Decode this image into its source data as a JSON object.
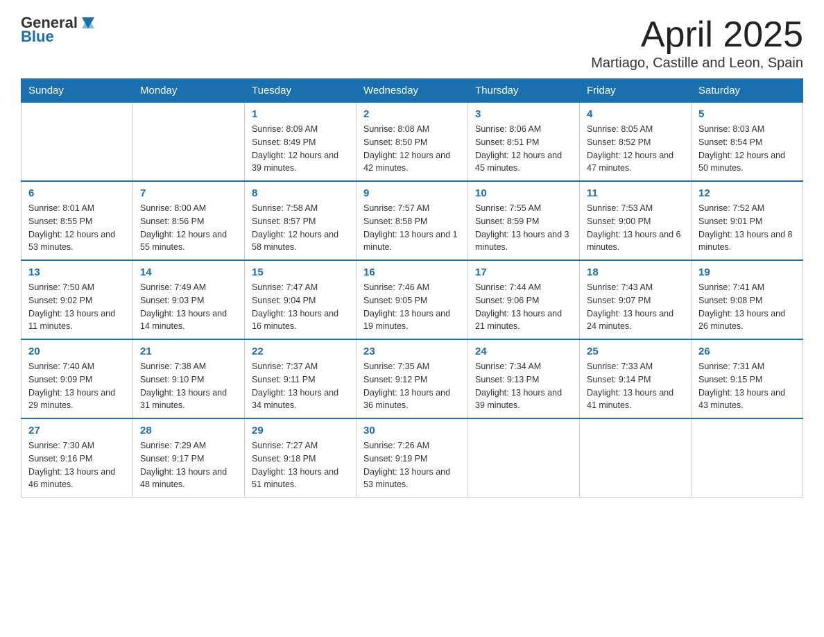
{
  "logo": {
    "general": "General",
    "blue": "Blue"
  },
  "title": "April 2025",
  "subtitle": "Martiago, Castille and Leon, Spain",
  "days_of_week": [
    "Sunday",
    "Monday",
    "Tuesday",
    "Wednesday",
    "Thursday",
    "Friday",
    "Saturday"
  ],
  "weeks": [
    [
      {
        "day": "",
        "sunrise": "",
        "sunset": "",
        "daylight": ""
      },
      {
        "day": "",
        "sunrise": "",
        "sunset": "",
        "daylight": ""
      },
      {
        "day": "1",
        "sunrise": "Sunrise: 8:09 AM",
        "sunset": "Sunset: 8:49 PM",
        "daylight": "Daylight: 12 hours and 39 minutes."
      },
      {
        "day": "2",
        "sunrise": "Sunrise: 8:08 AM",
        "sunset": "Sunset: 8:50 PM",
        "daylight": "Daylight: 12 hours and 42 minutes."
      },
      {
        "day": "3",
        "sunrise": "Sunrise: 8:06 AM",
        "sunset": "Sunset: 8:51 PM",
        "daylight": "Daylight: 12 hours and 45 minutes."
      },
      {
        "day": "4",
        "sunrise": "Sunrise: 8:05 AM",
        "sunset": "Sunset: 8:52 PM",
        "daylight": "Daylight: 12 hours and 47 minutes."
      },
      {
        "day": "5",
        "sunrise": "Sunrise: 8:03 AM",
        "sunset": "Sunset: 8:54 PM",
        "daylight": "Daylight: 12 hours and 50 minutes."
      }
    ],
    [
      {
        "day": "6",
        "sunrise": "Sunrise: 8:01 AM",
        "sunset": "Sunset: 8:55 PM",
        "daylight": "Daylight: 12 hours and 53 minutes."
      },
      {
        "day": "7",
        "sunrise": "Sunrise: 8:00 AM",
        "sunset": "Sunset: 8:56 PM",
        "daylight": "Daylight: 12 hours and 55 minutes."
      },
      {
        "day": "8",
        "sunrise": "Sunrise: 7:58 AM",
        "sunset": "Sunset: 8:57 PM",
        "daylight": "Daylight: 12 hours and 58 minutes."
      },
      {
        "day": "9",
        "sunrise": "Sunrise: 7:57 AM",
        "sunset": "Sunset: 8:58 PM",
        "daylight": "Daylight: 13 hours and 1 minute."
      },
      {
        "day": "10",
        "sunrise": "Sunrise: 7:55 AM",
        "sunset": "Sunset: 8:59 PM",
        "daylight": "Daylight: 13 hours and 3 minutes."
      },
      {
        "day": "11",
        "sunrise": "Sunrise: 7:53 AM",
        "sunset": "Sunset: 9:00 PM",
        "daylight": "Daylight: 13 hours and 6 minutes."
      },
      {
        "day": "12",
        "sunrise": "Sunrise: 7:52 AM",
        "sunset": "Sunset: 9:01 PM",
        "daylight": "Daylight: 13 hours and 8 minutes."
      }
    ],
    [
      {
        "day": "13",
        "sunrise": "Sunrise: 7:50 AM",
        "sunset": "Sunset: 9:02 PM",
        "daylight": "Daylight: 13 hours and 11 minutes."
      },
      {
        "day": "14",
        "sunrise": "Sunrise: 7:49 AM",
        "sunset": "Sunset: 9:03 PM",
        "daylight": "Daylight: 13 hours and 14 minutes."
      },
      {
        "day": "15",
        "sunrise": "Sunrise: 7:47 AM",
        "sunset": "Sunset: 9:04 PM",
        "daylight": "Daylight: 13 hours and 16 minutes."
      },
      {
        "day": "16",
        "sunrise": "Sunrise: 7:46 AM",
        "sunset": "Sunset: 9:05 PM",
        "daylight": "Daylight: 13 hours and 19 minutes."
      },
      {
        "day": "17",
        "sunrise": "Sunrise: 7:44 AM",
        "sunset": "Sunset: 9:06 PM",
        "daylight": "Daylight: 13 hours and 21 minutes."
      },
      {
        "day": "18",
        "sunrise": "Sunrise: 7:43 AM",
        "sunset": "Sunset: 9:07 PM",
        "daylight": "Daylight: 13 hours and 24 minutes."
      },
      {
        "day": "19",
        "sunrise": "Sunrise: 7:41 AM",
        "sunset": "Sunset: 9:08 PM",
        "daylight": "Daylight: 13 hours and 26 minutes."
      }
    ],
    [
      {
        "day": "20",
        "sunrise": "Sunrise: 7:40 AM",
        "sunset": "Sunset: 9:09 PM",
        "daylight": "Daylight: 13 hours and 29 minutes."
      },
      {
        "day": "21",
        "sunrise": "Sunrise: 7:38 AM",
        "sunset": "Sunset: 9:10 PM",
        "daylight": "Daylight: 13 hours and 31 minutes."
      },
      {
        "day": "22",
        "sunrise": "Sunrise: 7:37 AM",
        "sunset": "Sunset: 9:11 PM",
        "daylight": "Daylight: 13 hours and 34 minutes."
      },
      {
        "day": "23",
        "sunrise": "Sunrise: 7:35 AM",
        "sunset": "Sunset: 9:12 PM",
        "daylight": "Daylight: 13 hours and 36 minutes."
      },
      {
        "day": "24",
        "sunrise": "Sunrise: 7:34 AM",
        "sunset": "Sunset: 9:13 PM",
        "daylight": "Daylight: 13 hours and 39 minutes."
      },
      {
        "day": "25",
        "sunrise": "Sunrise: 7:33 AM",
        "sunset": "Sunset: 9:14 PM",
        "daylight": "Daylight: 13 hours and 41 minutes."
      },
      {
        "day": "26",
        "sunrise": "Sunrise: 7:31 AM",
        "sunset": "Sunset: 9:15 PM",
        "daylight": "Daylight: 13 hours and 43 minutes."
      }
    ],
    [
      {
        "day": "27",
        "sunrise": "Sunrise: 7:30 AM",
        "sunset": "Sunset: 9:16 PM",
        "daylight": "Daylight: 13 hours and 46 minutes."
      },
      {
        "day": "28",
        "sunrise": "Sunrise: 7:29 AM",
        "sunset": "Sunset: 9:17 PM",
        "daylight": "Daylight: 13 hours and 48 minutes."
      },
      {
        "day": "29",
        "sunrise": "Sunrise: 7:27 AM",
        "sunset": "Sunset: 9:18 PM",
        "daylight": "Daylight: 13 hours and 51 minutes."
      },
      {
        "day": "30",
        "sunrise": "Sunrise: 7:26 AM",
        "sunset": "Sunset: 9:19 PM",
        "daylight": "Daylight: 13 hours and 53 minutes."
      },
      {
        "day": "",
        "sunrise": "",
        "sunset": "",
        "daylight": ""
      },
      {
        "day": "",
        "sunrise": "",
        "sunset": "",
        "daylight": ""
      },
      {
        "day": "",
        "sunrise": "",
        "sunset": "",
        "daylight": ""
      }
    ]
  ]
}
